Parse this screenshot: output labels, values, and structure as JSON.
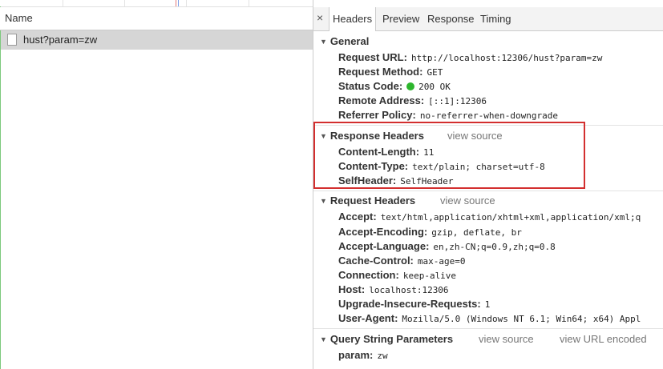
{
  "network_list": {
    "column_header": "Name",
    "requests": [
      {
        "name": "hust?param=zw"
      }
    ]
  },
  "detail_tabs": {
    "close_glyph": "×",
    "tabs": [
      "Headers",
      "Preview",
      "Response",
      "Timing"
    ],
    "active_tab": "Headers"
  },
  "general": {
    "title": "General",
    "request_url_key": "Request URL:",
    "request_url": "http://localhost:12306/hust?param=zw",
    "request_method_key": "Request Method:",
    "request_method": "GET",
    "status_code_key": "Status Code:",
    "status_code": "200 OK",
    "status_color": "#2db62d",
    "remote_address_key": "Remote Address:",
    "remote_address": "[::1]:12306",
    "referrer_policy_key": "Referrer Policy:",
    "referrer_policy": "no-referrer-when-downgrade"
  },
  "response_headers": {
    "title": "Response Headers",
    "view_source": "view source",
    "content_length_key": "Content-Length:",
    "content_length": "11",
    "content_type_key": "Content-Type:",
    "content_type": "text/plain; charset=utf-8",
    "self_header_key": "SelfHeader:",
    "self_header": "SelfHeader",
    "highlight_color": "#d32f2f"
  },
  "request_headers": {
    "title": "Request Headers",
    "view_source": "view source",
    "accept_key": "Accept:",
    "accept": "text/html,application/xhtml+xml,application/xml;q",
    "accept_encoding_key": "Accept-Encoding:",
    "accept_encoding": "gzip, deflate, br",
    "accept_language_key": "Accept-Language:",
    "accept_language": "en,zh-CN;q=0.9,zh;q=0.8",
    "cache_control_key": "Cache-Control:",
    "cache_control": "max-age=0",
    "connection_key": "Connection:",
    "connection": "keep-alive",
    "host_key": "Host:",
    "host": "localhost:12306",
    "upgrade_key": "Upgrade-Insecure-Requests:",
    "upgrade": "1",
    "user_agent_key": "User-Agent:",
    "user_agent": "Mozilla/5.0 (Windows NT 6.1; Win64; x64) Appl"
  },
  "query_string": {
    "title": "Query String Parameters",
    "view_source": "view source",
    "view_url_encoded": "view URL encoded",
    "param_key": "param:",
    "param_value": "zw"
  }
}
